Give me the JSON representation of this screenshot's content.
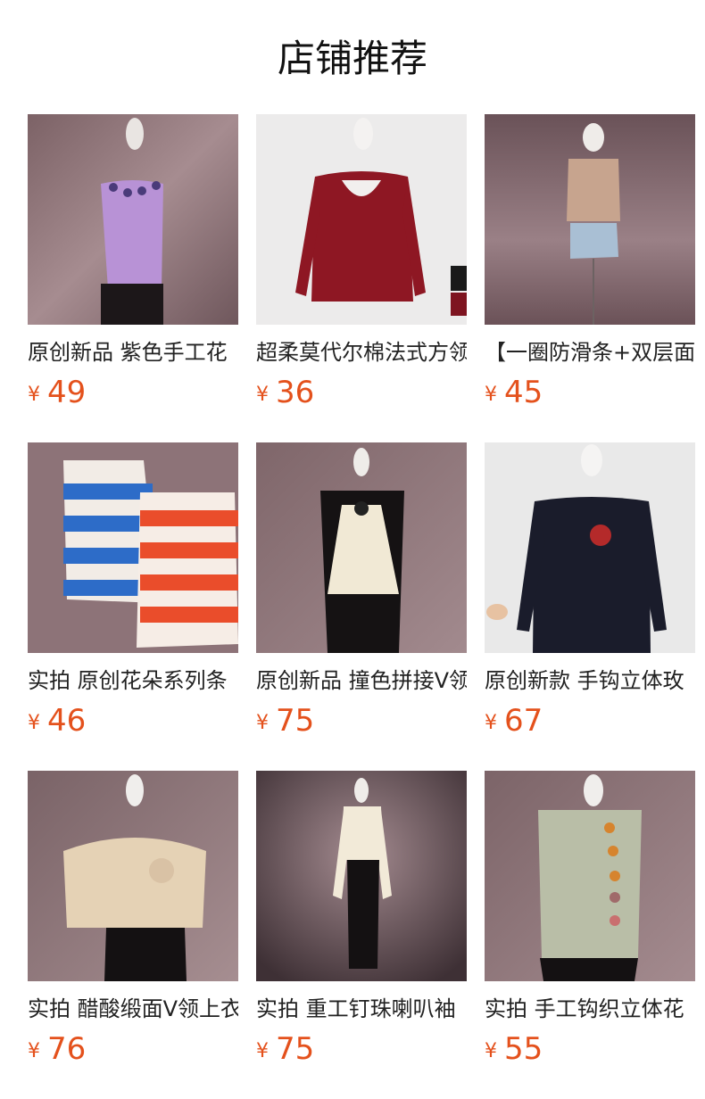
{
  "header": {
    "title": "店铺推荐"
  },
  "colors": {
    "price": "#e4511c",
    "title": "#111111",
    "text": "#222222"
  },
  "products": [
    {
      "name": "原创新品 紫色手工花",
      "currency": "¥",
      "price": "49",
      "image": "purple-knit-tank-top-with-flowers"
    },
    {
      "name": "超柔莫代尔棉法式方领",
      "currency": "¥",
      "price": "36",
      "image": "red-long-sleeve-top"
    },
    {
      "name": "【一圈防滑条+双层面",
      "currency": "¥",
      "price": "45",
      "image": "tie-dye-tube-top-with-denim-shorts"
    },
    {
      "name": "实拍 原创花朵系列条",
      "currency": "¥",
      "price": "46",
      "image": "striped-knit-tank-tops"
    },
    {
      "name": "原创新品 撞色拼接V领",
      "currency": "¥",
      "price": "75",
      "image": "black-and-cream-v-neck-dress"
    },
    {
      "name": "原创新款 手钩立体玫",
      "currency": "¥",
      "price": "67",
      "image": "navy-top-with-crochet-rose"
    },
    {
      "name": "实拍 醋酸缎面V领上衣",
      "currency": "¥",
      "price": "76",
      "image": "champagne-satin-wrap-top"
    },
    {
      "name": "实拍 重工钉珠喇叭袖",
      "currency": "¥",
      "price": "75",
      "image": "cream-blouse-with-black-skirt"
    },
    {
      "name": "实拍 手工钩织立体花",
      "currency": "¥",
      "price": "55",
      "image": "sage-knit-top-with-crochet-flowers"
    }
  ]
}
